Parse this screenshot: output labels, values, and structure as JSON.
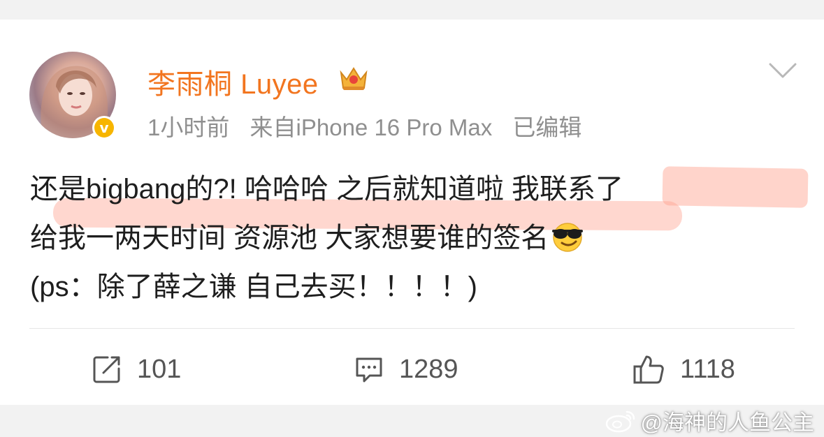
{
  "post": {
    "author": "李雨桐 Luyee",
    "time": "1小时前",
    "source": "来自iPhone 16 Pro Max",
    "edited": "已编辑",
    "verified_badge": "v",
    "lines": [
      "还是bigbang的?!  哈哈哈 之后就知道啦 我联系了",
      "给我一两天时间 资源池 大家想要谁的签名",
      "(ps：除了薛之谦 自己去买！！！！)"
    ]
  },
  "actions": {
    "repost_count": "101",
    "comment_count": "1289",
    "like_count": "1118"
  },
  "watermark": "@海神的人鱼公主",
  "icons": {
    "crown": "crown-icon",
    "chevron": "chevron-down-icon",
    "repost": "repost-icon",
    "comment": "comment-icon",
    "like": "thumbs-up-icon",
    "emoji": "sunglasses-emoji-icon"
  },
  "colors": {
    "author": "#f2751f",
    "meta": "#8f8f8f",
    "highlight": "#ffa08c"
  }
}
